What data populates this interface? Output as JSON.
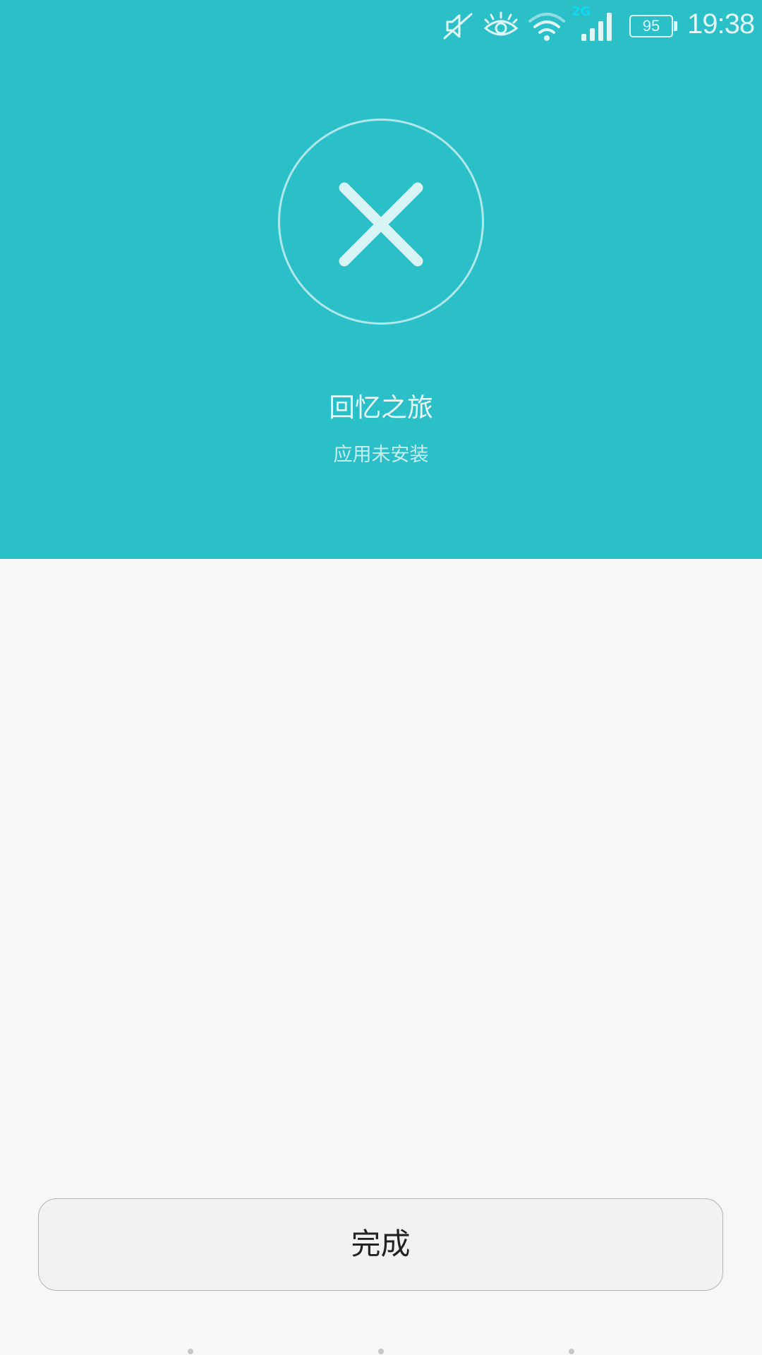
{
  "status_bar": {
    "network_type": "2G",
    "battery_level": "95",
    "time": "19:38",
    "icons": [
      "mute-icon",
      "eye-comfort-icon",
      "wifi-icon",
      "signal-icon",
      "battery-icon"
    ]
  },
  "result": {
    "icon": "close-icon",
    "app_name": "回忆之旅",
    "status_text": "应用未安装"
  },
  "actions": {
    "done_label": "完成"
  },
  "colors": {
    "header_background": "#2bbfc7",
    "page_background": "#f7f7f7",
    "accent_light": "#dff7f8"
  }
}
